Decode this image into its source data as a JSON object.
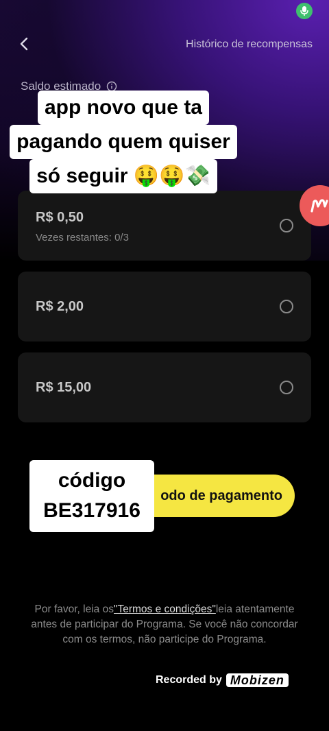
{
  "header": {
    "history_label": "Histórico de recompensas"
  },
  "balance": {
    "label": "Saldo estimado"
  },
  "caption": {
    "line1": "app novo que ta",
    "line2": "pagando quem quiser",
    "line3": "só seguir 🤑🤑💸"
  },
  "options": [
    {
      "amount": "R$ 0,50",
      "subtitle": "Vezes restantes: 0/3"
    },
    {
      "amount": "R$ 2,00"
    },
    {
      "amount": "R$ 15,00"
    }
  ],
  "payment_button": {
    "label": "odo de pagamento"
  },
  "code_overlay": {
    "line1": "código",
    "line2": "BE317916"
  },
  "terms": {
    "prefix": "Por favor, leia os",
    "link": "\"Termos e condições\"",
    "suffix": "leia atentamente antes de participar do Programa. Se você não concordar com os termos, não participe do Programa."
  },
  "watermark": {
    "prefix": "Recorded by",
    "brand": "Mobizen"
  },
  "colors": {
    "accent_yellow": "#f5e642",
    "badge_red": "#ec5a5a",
    "mic_green": "#3fbf6e"
  },
  "icons": [
    "back-arrow-icon",
    "info-icon",
    "mic-icon",
    "mobizen-badge-icon"
  ]
}
